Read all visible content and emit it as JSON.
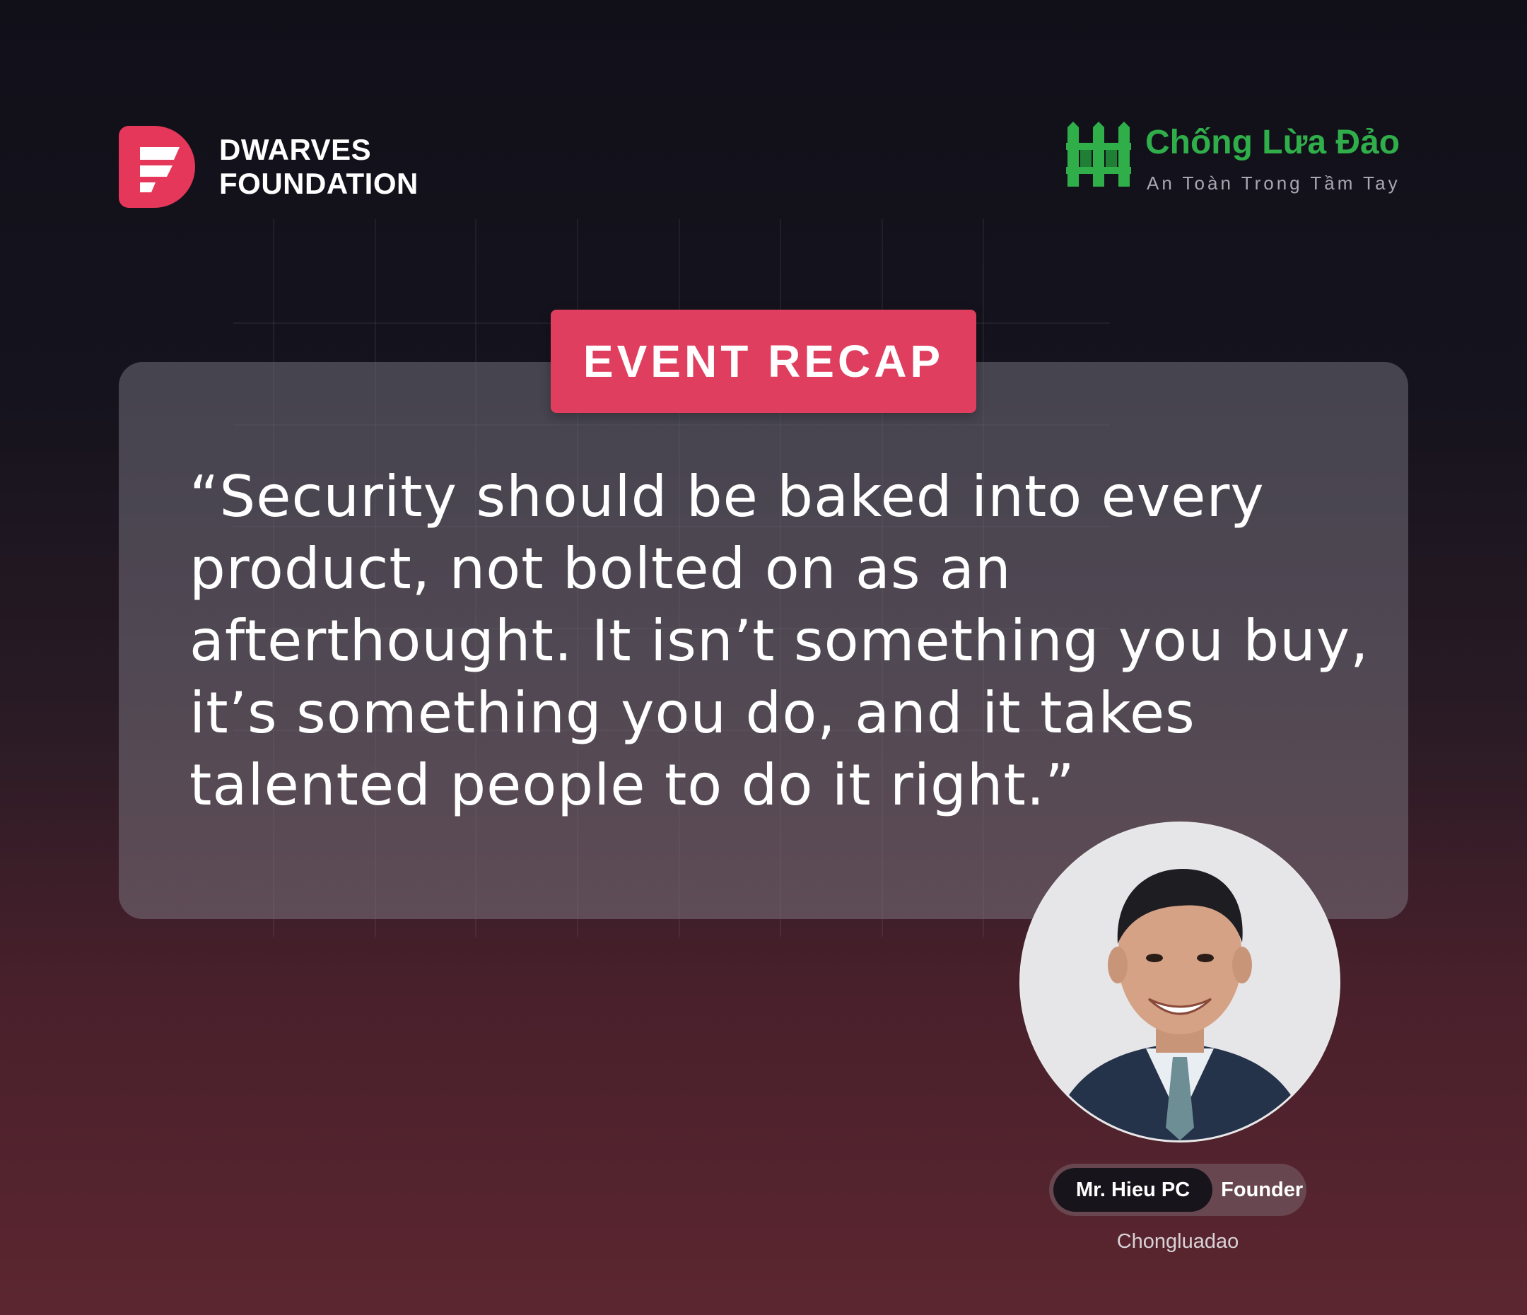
{
  "brand": {
    "dwarves": {
      "line1": "DWARVES",
      "line2": "FOUNDATION",
      "logo_icon": "dwarves-f-icon",
      "color": "#e5375a"
    },
    "partner": {
      "title": "Chống Lừa Đảo",
      "subtitle": "An Toàn Trong Tầm Tay",
      "logo_icon": "fence-icon",
      "color": "#2fae4a"
    }
  },
  "badge": {
    "label": "EVENT RECAP",
    "color": "#e03e5f"
  },
  "quote": {
    "text": "“Security should be baked into every product, not bolted on as an afterthought. It isn’t something you buy, it’s something you do, and it takes talented people to do it right.”"
  },
  "speaker": {
    "name": "Mr. Hieu PC",
    "role": "Founder",
    "organization": "Chongluadao",
    "photo_icon": "speaker-avatar"
  }
}
